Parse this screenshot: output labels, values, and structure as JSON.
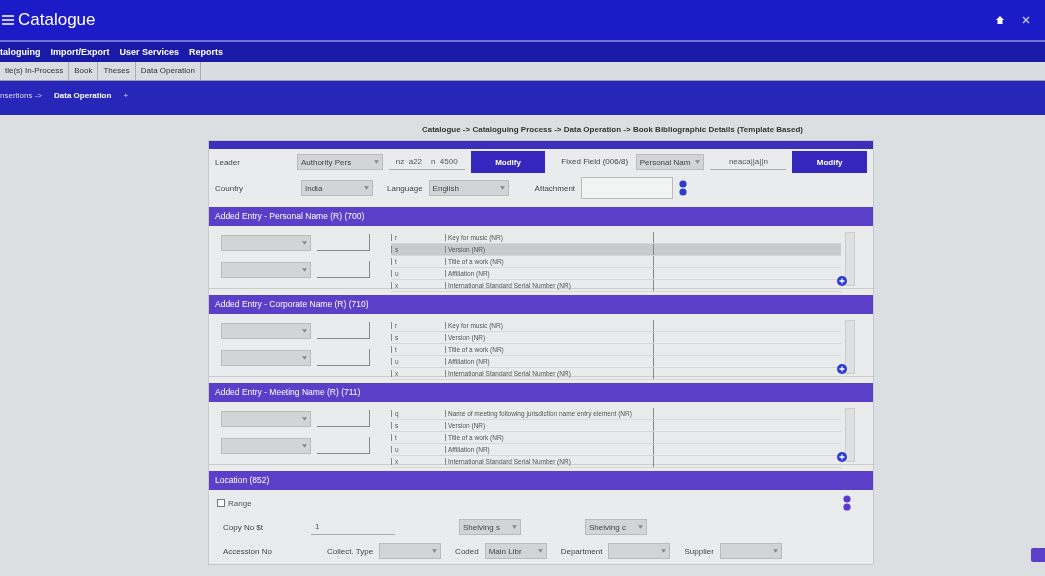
{
  "app": {
    "title": "Catalogue"
  },
  "menu": [
    {
      "label": "taloguing"
    },
    {
      "label": "Import/Export"
    },
    {
      "label": "User Services"
    },
    {
      "label": "Reports"
    }
  ],
  "tabs": [
    {
      "label": "tle(s) In-Process"
    },
    {
      "label": "Book"
    },
    {
      "label": "Theses"
    },
    {
      "label": "Data Operation"
    }
  ],
  "breadcrumb": [
    {
      "label": "nsertions ->",
      "current": false
    },
    {
      "label": "Data Operation",
      "current": true
    },
    {
      "label": "+",
      "current": false
    }
  ],
  "page_path": "Catalogue -> Cataloguing Process -> Data Operation -> Book Bibliographic Details (Template Based)",
  "leader": {
    "label": "Leader",
    "select": "Authority Pers",
    "value": "nz  a22    n  4500",
    "button": "Modify",
    "fixed_label": "Fixed Field (006/8)",
    "fixed_select": "Personal Nam",
    "fixed_value": "neaca||a||n",
    "fixed_button": "Modify"
  },
  "country_row": {
    "country_label": "Country",
    "country": "India",
    "language_label": "Language",
    "language": "English",
    "attachment_label": "Attachment"
  },
  "sections": [
    {
      "title": "Added Entry - Personal Name (R) (700)",
      "rows": [
        {
          "code": "r",
          "label": "Key for music (NR)",
          "selected": false
        },
        {
          "code": "s",
          "label": "Version (NR)",
          "selected": true
        },
        {
          "code": "t",
          "label": "Title of a work (NR)",
          "selected": false
        },
        {
          "code": "u",
          "label": "Affiliation (NR)",
          "selected": false
        },
        {
          "code": "x",
          "label": "International Standard Serial Number (NR)",
          "selected": false
        }
      ]
    },
    {
      "title": "Added Entry - Corporate Name (R) (710)",
      "rows": [
        {
          "code": "r",
          "label": "Key for music (NR)",
          "selected": false
        },
        {
          "code": "s",
          "label": "Version (NR)",
          "selected": false
        },
        {
          "code": "t",
          "label": "Title of a work (NR)",
          "selected": false
        },
        {
          "code": "u",
          "label": "Affiliation (NR)",
          "selected": false
        },
        {
          "code": "x",
          "label": "International Standard Serial Number (NR)",
          "selected": false
        }
      ]
    },
    {
      "title": "Added Entry - Meeting Name (R) (711)",
      "rows": [
        {
          "code": "q",
          "label": "Name of meeting following jurisdiction name entry element (NR)",
          "selected": false
        },
        {
          "code": "s",
          "label": "Version (NR)",
          "selected": false
        },
        {
          "code": "t",
          "label": "Title of a work (NR)",
          "selected": false
        },
        {
          "code": "u",
          "label": "Affiliation (NR)",
          "selected": false
        },
        {
          "code": "x",
          "label": "International Standard Serial Number (NR)",
          "selected": false
        }
      ]
    }
  ],
  "location": {
    "title": "Location (852)",
    "range": {
      "label": "Range",
      "checked": false
    },
    "copy_label": "Copy No $t",
    "copy_value": "1",
    "shelving_1": "Shelving s",
    "shelving_2": "Shelving c",
    "accession_label": "Accession No",
    "collect_label": "Collect. Type",
    "coded_label": "Coded",
    "library": "Main Libr",
    "department_label": "Department",
    "supplier_label": "Supplier"
  }
}
